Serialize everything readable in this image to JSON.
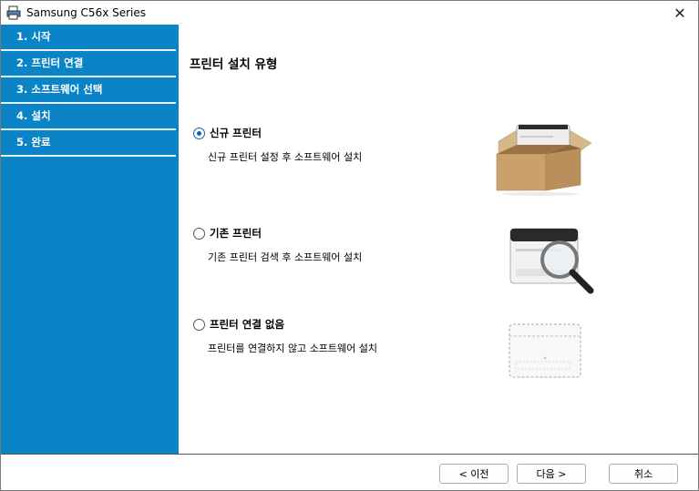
{
  "window": {
    "title": "Samsung C56x Series",
    "close_glyph": "✕"
  },
  "sidebar": {
    "steps": [
      {
        "label": "1. 시작"
      },
      {
        "label": "2. 프린터 연결"
      },
      {
        "label": "3. 소프트웨어 선택"
      },
      {
        "label": "4. 설치"
      },
      {
        "label": "5. 완료"
      }
    ],
    "active_index": 1,
    "color": "#0a84c6"
  },
  "main": {
    "heading": "프린터 설치 유형",
    "options": [
      {
        "label": "신규 프린터",
        "description": "신규 프린터 설정 후 소프트웨어 설치",
        "selected": true,
        "icon": "printer-in-box-icon"
      },
      {
        "label": "기존 프린터",
        "description": "기존 프린터 검색 후 소프트웨어 설치",
        "selected": false,
        "icon": "printer-magnifier-icon"
      },
      {
        "label": "프린터 연결 없음",
        "description": "프린터를 연결하지 않고 소프트웨어 설치",
        "selected": false,
        "icon": "printer-outline-icon"
      }
    ]
  },
  "footer": {
    "back_label": "< 이전",
    "next_label": "다음 >",
    "cancel_label": "취소"
  }
}
